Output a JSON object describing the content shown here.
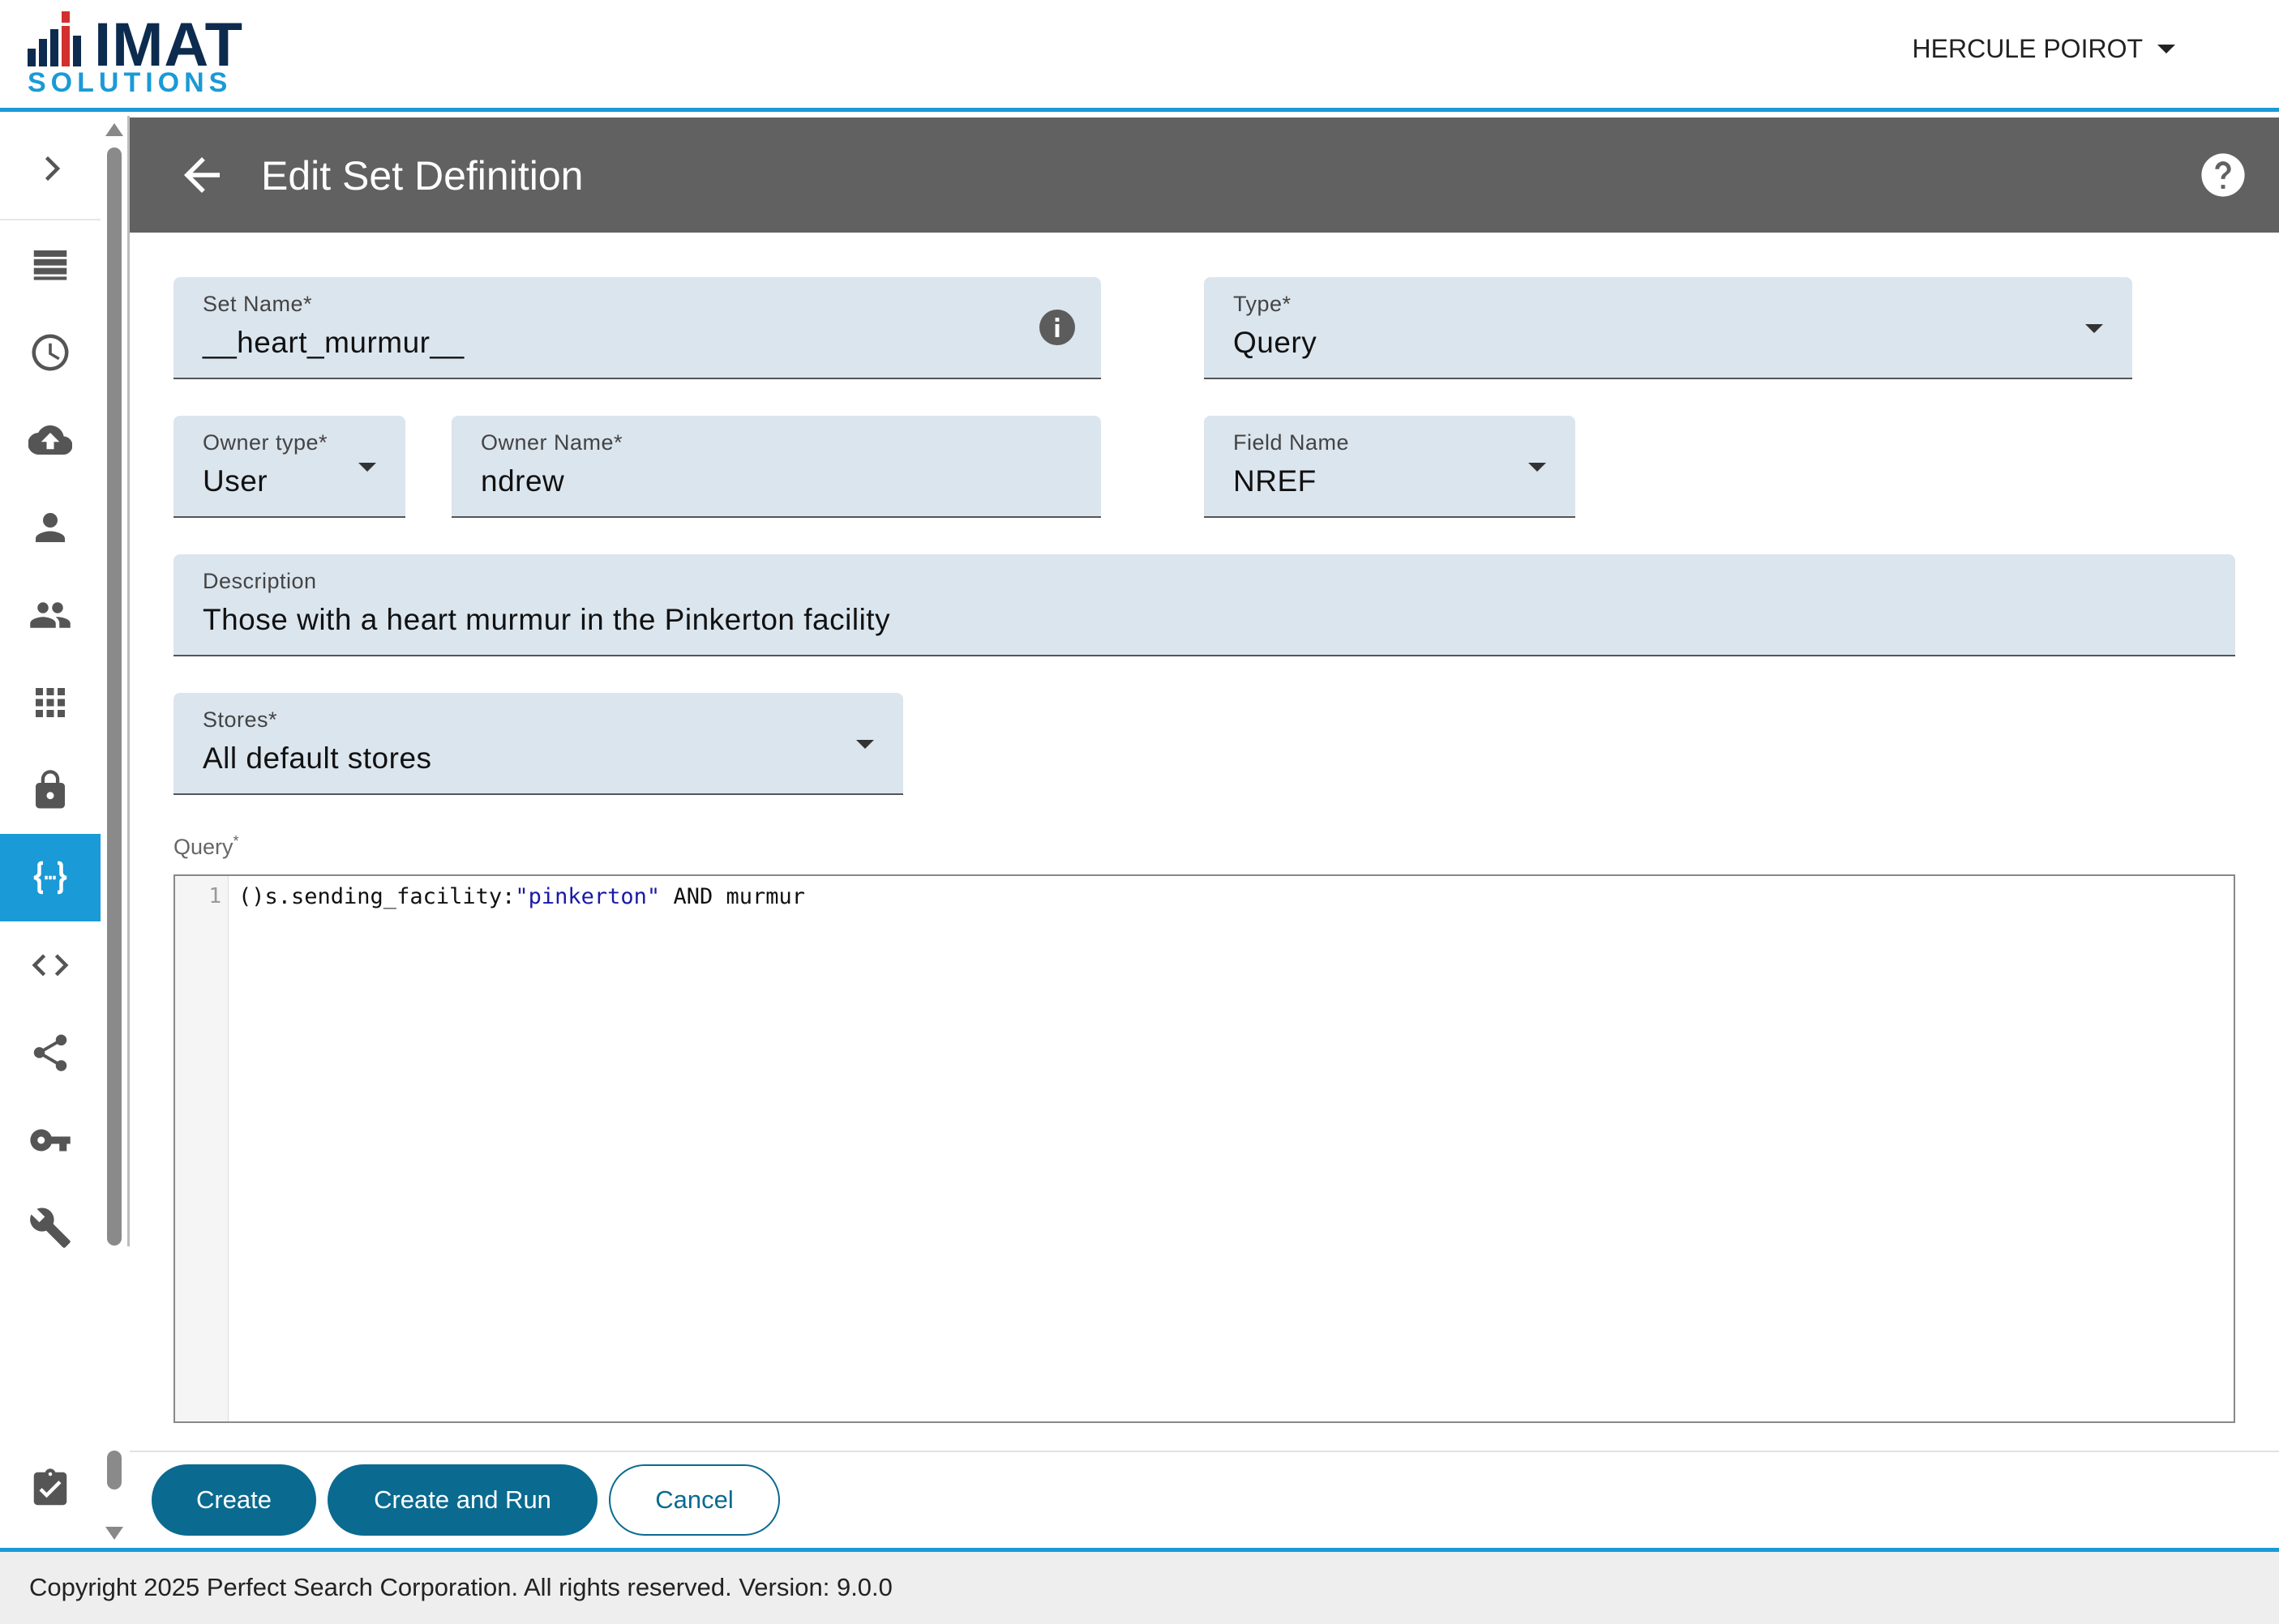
{
  "app": {
    "logo_top": "IMAT",
    "logo_bottom": "SOLUTIONS",
    "user_name": "HERCULE POIROT"
  },
  "colors": {
    "accent": "#1a9ad6",
    "titlebar": "#616161",
    "primary_button": "#0a6a90",
    "field_bg": "#dbe5ee"
  },
  "sidebar": {
    "items": [
      {
        "icon": "chevron-right-icon"
      },
      {
        "icon": "list-icon"
      },
      {
        "icon": "history-icon"
      },
      {
        "icon": "cloud-upload-icon"
      },
      {
        "icon": "person-icon"
      },
      {
        "icon": "people-icon"
      },
      {
        "icon": "apps-grid-icon"
      },
      {
        "icon": "lock-icon"
      },
      {
        "icon": "curly-braces-icon",
        "active": true
      },
      {
        "icon": "code-icon"
      },
      {
        "icon": "share-icon"
      },
      {
        "icon": "key-icon"
      },
      {
        "icon": "wrench-icon"
      },
      {
        "icon": "clipboard-check-icon"
      }
    ]
  },
  "header": {
    "title": "Edit Set Definition"
  },
  "form": {
    "set_name": {
      "label": "Set Name*",
      "value": "__heart_murmur__"
    },
    "type": {
      "label": "Type*",
      "value": "Query"
    },
    "owner_type": {
      "label": "Owner type*",
      "value": "User"
    },
    "owner_name": {
      "label": "Owner Name*",
      "value": "ndrew"
    },
    "field_name": {
      "label": "Field Name",
      "value": "NREF"
    },
    "description": {
      "label": "Description",
      "value": "Those with a heart murmur in the Pinkerton facility"
    },
    "stores": {
      "label": "Stores*",
      "value": "All default stores"
    },
    "query": {
      "label": "Query",
      "required_mark": "*",
      "line_number": "1",
      "code_prefix": "()s.sending_facility:",
      "code_string": "\"pinkerton\"",
      "code_suffix": " AND murmur"
    }
  },
  "actions": {
    "create": "Create",
    "create_and_run": "Create and Run",
    "cancel": "Cancel"
  },
  "footer": {
    "text": "Copyright 2025 Perfect Search Corporation. All rights reserved. Version: 9.0.0"
  }
}
